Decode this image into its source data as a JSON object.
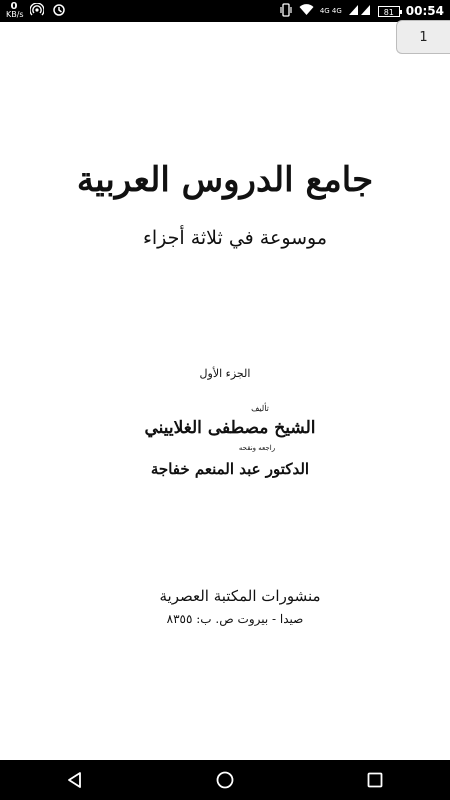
{
  "status_bar": {
    "net_speed_value": "0",
    "net_speed_unit": "KB/s",
    "signal_label": "4G 4G",
    "battery": "81",
    "time": "00:54"
  },
  "viewer": {
    "page_number": "1"
  },
  "cover": {
    "title": "جامع الدروس العربية",
    "subtitle": "موسوعة في ثلاثة أجزاء",
    "part": "الجزء الأول",
    "author_label": "تأليف",
    "author": "الشيخ مصطفى الغلاييني",
    "reviser_label": "راجعه ونقحه",
    "reviser": "الدكتور عبد المنعم خفاجة",
    "publisher": "منشورات المكتبة العصرية",
    "address": "صيدا - بيروت ص. ب: ٨٣٥٥"
  },
  "icons": {
    "status_left": [
      "hotspot-icon",
      "sync-icon"
    ],
    "status_right": [
      "vibrate-icon",
      "wifi-icon",
      "signal-icon",
      "battery-icon"
    ],
    "nav": [
      "back-icon",
      "home-icon",
      "recents-icon"
    ]
  }
}
